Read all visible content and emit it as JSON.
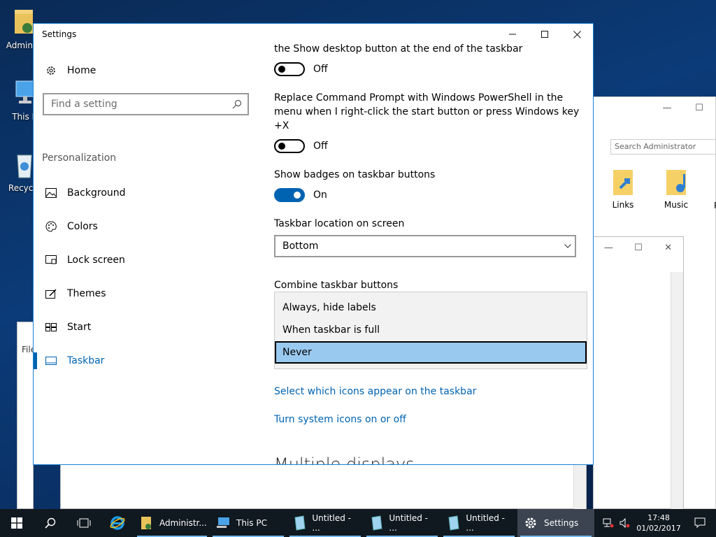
{
  "desktop": {
    "icons": [
      {
        "label": "Administ"
      },
      {
        "label": "This P"
      },
      {
        "label": "Recycle"
      },
      {
        "label": "File"
      }
    ]
  },
  "background_explorer": {
    "search_placeholder": "Search Administrator",
    "items": [
      {
        "label": "Links"
      },
      {
        "label": "Music"
      },
      {
        "label": "P"
      }
    ]
  },
  "settings": {
    "window_title": "Settings",
    "nav": {
      "home_label": "Home",
      "search_placeholder": "Find a setting",
      "section_heading": "Personalization",
      "items": [
        {
          "label": "Background",
          "icon": "picture-icon"
        },
        {
          "label": "Colors",
          "icon": "palette-icon"
        },
        {
          "label": "Lock screen",
          "icon": "lock-screen-icon"
        },
        {
          "label": "Themes",
          "icon": "themes-icon"
        },
        {
          "label": "Start",
          "icon": "start-icon"
        },
        {
          "label": "Taskbar",
          "icon": "taskbar-icon",
          "active": true
        }
      ]
    },
    "content": {
      "peek_text": "the Show desktop button at the end of the taskbar",
      "peek_toggle_state": "Off",
      "powershell_text_1": "Replace Command Prompt with Windows PowerShell in the",
      "powershell_text_2": "menu when I right-click the start button or press Windows key",
      "powershell_text_3": "+X",
      "powershell_toggle_state": "Off",
      "badges_label": "Show badges on taskbar buttons",
      "badges_toggle_state": "On",
      "location_label": "Taskbar location on screen",
      "location_value": "Bottom",
      "combine_label": "Combine taskbar buttons",
      "combine_options": [
        "Always, hide labels",
        "When taskbar is full",
        "Never"
      ],
      "combine_selected": "Never",
      "link_icons": "Select which icons appear on the taskbar",
      "link_system_icons": "Turn system icons on or off",
      "next_heading": "Multiple displays"
    }
  },
  "taskbar": {
    "apps": [
      {
        "label": "Administr..."
      },
      {
        "label": "This PC"
      },
      {
        "label": "Untitled - ..."
      },
      {
        "label": "Untitled - ..."
      },
      {
        "label": "Untitled - ..."
      },
      {
        "label": "Settings"
      }
    ],
    "clock_time": "17:48",
    "clock_date": "01/02/2017"
  },
  "colors": {
    "accent": "#0063b1",
    "selection": "#99c9ef",
    "taskbar": "#101820"
  }
}
